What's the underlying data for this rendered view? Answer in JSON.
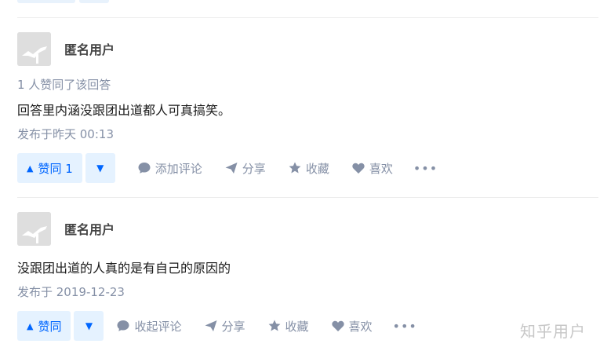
{
  "answers": [
    {
      "author": "匿名用户",
      "voters": "1 人赞同了该回答",
      "content": "回答里内涵没跟团出道都人可真搞笑。",
      "time": "发布于昨天 00:13",
      "vote_label": "赞同 1",
      "comment_label": "添加评论",
      "share_label": "分享",
      "collect_label": "收藏",
      "like_label": "喜欢"
    },
    {
      "author": "匿名用户",
      "content": "没跟团出道的人真的是有自己的原因的",
      "time": "发布于 2019-12-23",
      "vote_label": "赞同",
      "comment_label": "收起评论",
      "share_label": "分享",
      "collect_label": "收藏",
      "like_label": "喜欢"
    }
  ],
  "icons": {
    "vote_up": "triangle-up-icon",
    "vote_down": "triangle-down-icon",
    "comment": "speech-bubble-icon",
    "share": "paper-plane-icon",
    "collect": "star-icon",
    "like": "heart-icon",
    "more": "ellipsis-icon"
  },
  "colors": {
    "accent": "#0066ff",
    "accent_bg": "#e5f2ff",
    "muted": "#8590a6"
  },
  "watermark": "知乎用户"
}
